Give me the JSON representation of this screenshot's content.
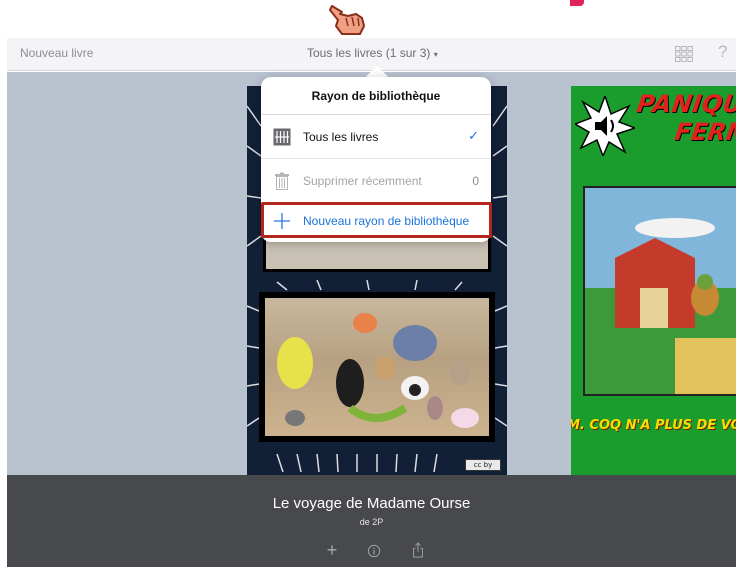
{
  "toolbar": {
    "new_book": "Nouveau livre",
    "shelf_title": "Tous les livres (1 sur 3)",
    "caret": "▾",
    "grid_icon": "grid-icon",
    "help": "?"
  },
  "popover": {
    "title": "Rayon de bibliothèque",
    "items": [
      {
        "label": "Tous les livres",
        "icon": "shelf-icon",
        "right": "✓"
      },
      {
        "label": "Supprimer récemment",
        "icon": "trash-icon",
        "right": "0"
      },
      {
        "label": "Nouveau rayon de bibliothèque",
        "icon": "plus-icon",
        "right": ""
      }
    ]
  },
  "books": {
    "right_title_line1": "PANIQU",
    "right_title_line2": "FERM",
    "right_caption": "M. COQ N'A PLUS DE VO"
  },
  "license_badge": "cc by",
  "bottom": {
    "title": "Le voyage de Madame Ourse",
    "author": "de 2P",
    "add": "+",
    "info": "ⓘ"
  },
  "colors": {
    "accent": "#1a73d9",
    "highlight": "#b3261e",
    "bottom_bar": "#48494c",
    "canvas": "#b9c3d0"
  }
}
